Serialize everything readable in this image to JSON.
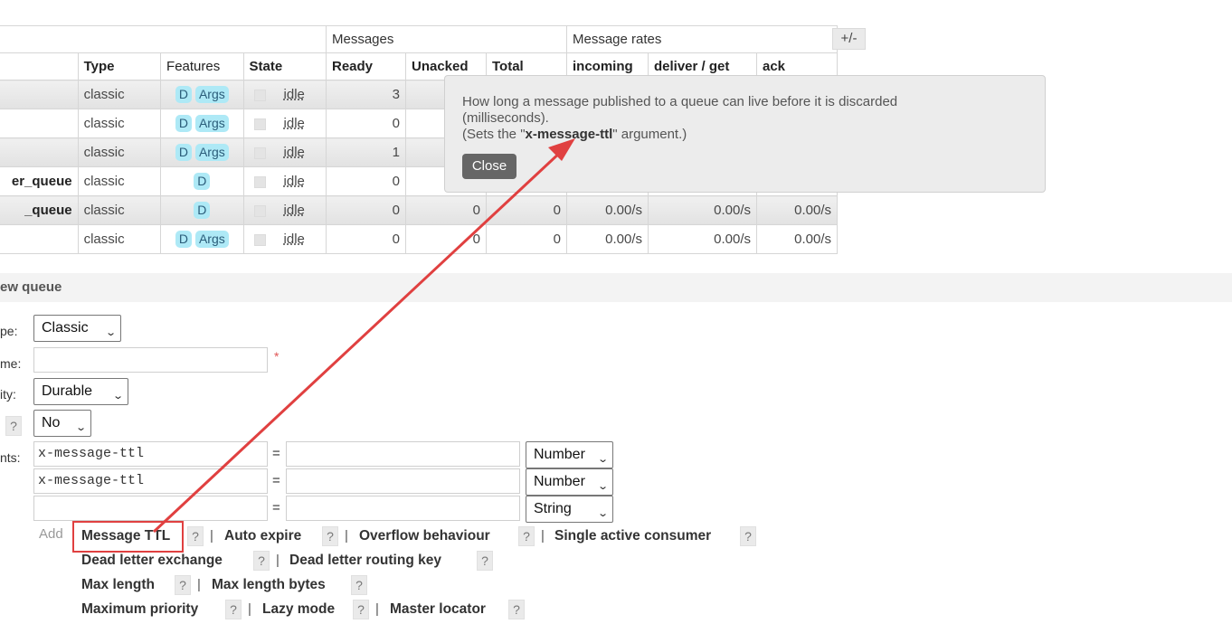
{
  "table": {
    "group_messages": "Messages",
    "group_rates": "Message rates",
    "headers": [
      "Type",
      "Features",
      "State",
      "Ready",
      "Unacked",
      "Total",
      "incoming",
      "deliver / get",
      "ack"
    ],
    "toggle": "+/-",
    "rows": [
      {
        "name": "",
        "type": "classic",
        "features": [
          "D",
          "Args"
        ],
        "state": "idle",
        "ready": "3",
        "unacked": "",
        "total": "",
        "incoming": "",
        "deliver": "",
        "ack": ""
      },
      {
        "name": "",
        "type": "classic",
        "features": [
          "D",
          "Args"
        ],
        "state": "idle",
        "ready": "0",
        "unacked": "",
        "total": "",
        "incoming": "",
        "deliver": "",
        "ack": ""
      },
      {
        "name": "",
        "type": "classic",
        "features": [
          "D",
          "Args"
        ],
        "state": "idle",
        "ready": "1",
        "unacked": "",
        "total": "",
        "incoming": "",
        "deliver": "",
        "ack": ""
      },
      {
        "name": "er_queue",
        "type": "classic",
        "features": [
          "D"
        ],
        "state": "idle",
        "ready": "0",
        "unacked": "",
        "total": "",
        "incoming": "",
        "deliver": "",
        "ack": ""
      },
      {
        "name": "_queue",
        "type": "classic",
        "features": [
          "D"
        ],
        "state": "idle",
        "ready": "0",
        "unacked": "0",
        "total": "0",
        "incoming": "0.00/s",
        "deliver": "0.00/s",
        "ack": "0.00/s"
      },
      {
        "name": "",
        "type": "classic",
        "features": [
          "D",
          "Args"
        ],
        "state": "idle",
        "ready": "0",
        "unacked": "0",
        "total": "0",
        "incoming": "0.00/s",
        "deliver": "0.00/s",
        "ack": "0.00/s"
      }
    ]
  },
  "form": {
    "section_title": "ew queue",
    "type_label": "pe:",
    "type_value": "Classic",
    "name_label": "me:",
    "name_value": "",
    "required_mark": "*",
    "durability_label": "ity:",
    "durability_value": "Durable",
    "autodelete_qmark": "?",
    "autodelete_value": "No",
    "arguments_label": "nts:",
    "arguments": [
      {
        "key": "x-message-ttl",
        "value": "",
        "type": "Number"
      },
      {
        "key": "x-message-ttl",
        "value": "",
        "type": "Number"
      },
      {
        "key": "",
        "value": "",
        "type": "String"
      }
    ],
    "equals": "=",
    "add_label": "Add",
    "qmark": "?",
    "separator": "|",
    "add_links": {
      "message_ttl": "Message TTL",
      "auto_expire": "Auto expire",
      "overflow": "Overflow behaviour",
      "single_active": "Single active consumer",
      "dlx": "Dead letter exchange",
      "dlrk": "Dead letter routing key",
      "max_length": "Max length",
      "max_length_bytes": "Max length bytes",
      "max_priority": "Maximum priority",
      "lazy": "Lazy mode",
      "master_locator": "Master locator"
    }
  },
  "tooltip": {
    "line1": "How long a message published to a queue can live before it is discarded",
    "line2": "(milliseconds).",
    "line3_prefix": "(Sets the \"",
    "line3_arg": "x-message-ttl",
    "line3_suffix": "\" argument.)",
    "close_label": "Close"
  },
  "annotation_color": "#e04040"
}
